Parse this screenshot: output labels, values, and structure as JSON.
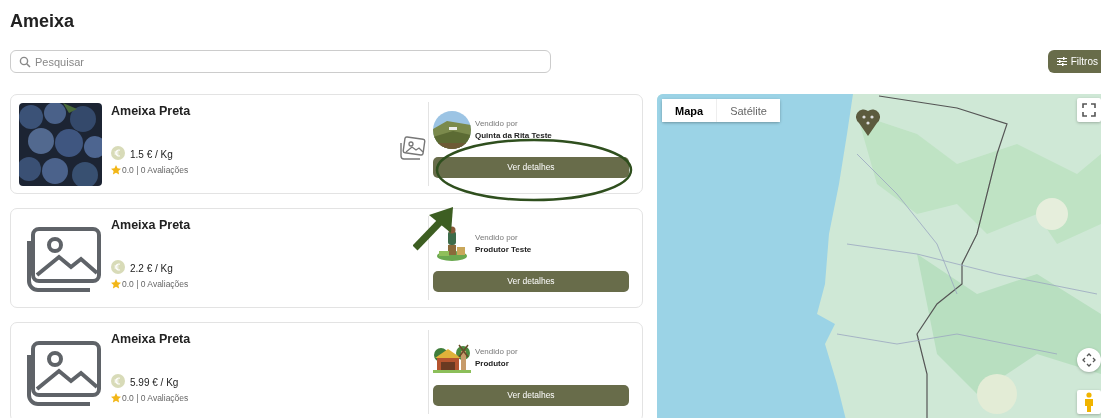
{
  "title": "Ameixa",
  "search": {
    "placeholder": "Pesquisar"
  },
  "filter_button": {
    "label": "Filtros"
  },
  "products": [
    {
      "name": "Ameixa Preta",
      "kind": "picture",
      "image_icon": true,
      "price": "1.5 € / Kg",
      "rating": "0.0 | 0 Avaliações",
      "seller_label": "Vendido por",
      "seller": "Quinta da Rita Teste",
      "button": "Ver detalhes"
    },
    {
      "name": "Ameixa Preta",
      "kind": "placeholder",
      "image_icon": false,
      "price": "2.2 € / Kg",
      "rating": "0.0 | 0 Avaliações",
      "seller_label": "Vendido por",
      "seller": "Produtor Teste",
      "button": "Ver detalhes"
    },
    {
      "name": "Ameixa Preta",
      "kind": "placeholder",
      "image_icon": false,
      "price": "5.99 € / Kg",
      "rating": "0.0 | 0 Avaliações",
      "seller_label": "Vendido por",
      "seller": "Produtor",
      "button": "Ver detalhes"
    }
  ],
  "map": {
    "tabs": [
      {
        "label": "Mapa",
        "selected": true
      },
      {
        "label": "Satélite",
        "selected": false
      }
    ]
  },
  "annotation": {
    "ellipse": true,
    "arrow": true
  }
}
